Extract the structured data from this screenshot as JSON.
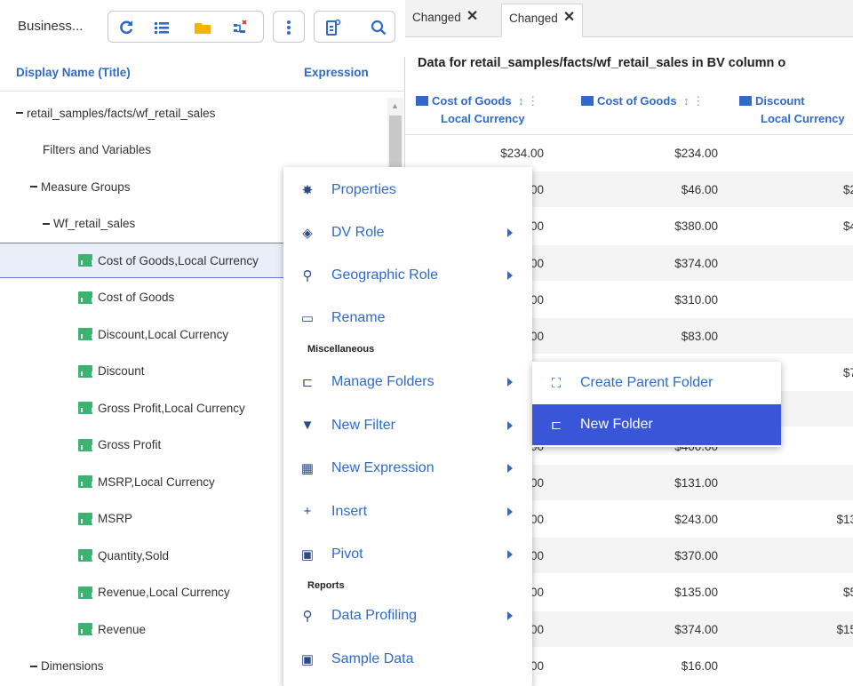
{
  "left_panel": {
    "title": "Business...",
    "col_display_name": "Display Name (Title)",
    "col_expression": "Expression",
    "tree": [
      {
        "label": "retail_samples/facts/wf_retail_sales",
        "type": "collapse"
      },
      {
        "label": "Filters and Variables",
        "type": "plain"
      },
      {
        "label": "Measure Groups",
        "type": "collapse"
      },
      {
        "label": "Wf_retail_sales",
        "type": "collapse"
      },
      {
        "label": "Cost of Goods,Local Currency",
        "type": "measure",
        "selected": true
      },
      {
        "label": "Cost of Goods",
        "type": "measure"
      },
      {
        "label": "Discount,Local Currency",
        "type": "measure"
      },
      {
        "label": "Discount",
        "type": "measure"
      },
      {
        "label": "Gross Profit,Local Currency",
        "type": "measure"
      },
      {
        "label": "Gross Profit",
        "type": "measure"
      },
      {
        "label": "MSRP,Local Currency",
        "type": "measure"
      },
      {
        "label": "MSRP",
        "type": "measure"
      },
      {
        "label": "Quantity,Sold",
        "type": "measure"
      },
      {
        "label": "Revenue,Local Currency",
        "type": "measure"
      },
      {
        "label": "Revenue",
        "type": "measure"
      },
      {
        "label": "Dimensions",
        "type": "collapse"
      }
    ]
  },
  "tabs": [
    {
      "label": "Changed"
    },
    {
      "label": "Changed"
    }
  ],
  "preview": {
    "title": "Data for retail_samples/facts/wf_retail_sales in BV column o",
    "headers": [
      {
        "line1": "Cost of Goods",
        "line2": "Local Currency"
      },
      {
        "line1": "Cost of Goods",
        "line2": ""
      },
      {
        "line1": "Discount",
        "line2": "Local Currency"
      }
    ],
    "rows": [
      [
        "$234.00",
        "$234.00",
        ""
      ],
      [
        "$46.00",
        "$46.00",
        "$2"
      ],
      [
        "$380.00",
        "$380.00",
        "$4"
      ],
      [
        "$374.00",
        "$374.00",
        ""
      ],
      [
        "$310.00",
        "$310.00",
        ""
      ],
      [
        "$83.00",
        "$83.00",
        ""
      ],
      [
        "",
        "",
        "$7"
      ],
      [
        "",
        "",
        ""
      ],
      [
        "$400.00",
        "$400.00",
        ""
      ],
      [
        "$131.00",
        "$131.00",
        ""
      ],
      [
        "$243.00",
        "$243.00",
        "$13"
      ],
      [
        "$370.00",
        "$370.00",
        ""
      ],
      [
        "$135.00",
        "$135.00",
        "$5"
      ],
      [
        "$374.00",
        "$374.00",
        "$15"
      ],
      [
        "$16.00",
        "$16.00",
        ""
      ]
    ],
    "left_fragments": [
      "6.00",
      "0.00",
      "4.00",
      "0.00",
      "3.00",
      "",
      "",
      "0.00",
      "1.00",
      "3.00",
      "0.00",
      "5.00",
      "4.00",
      "6.00"
    ]
  },
  "context_menu": {
    "items": [
      {
        "label": "Properties",
        "icon": "gear-icon",
        "submenu": false
      },
      {
        "label": "DV Role",
        "icon": "cube-icon",
        "submenu": true
      },
      {
        "label": "Geographic Role",
        "icon": "map-pin-icon",
        "submenu": true
      },
      {
        "label": "Rename",
        "icon": "rename-icon",
        "submenu": false
      }
    ],
    "section_misc": "Miscellaneous",
    "misc_items": [
      {
        "label": "Manage Folders",
        "icon": "folder-open-icon",
        "submenu": true
      },
      {
        "label": "New Filter",
        "icon": "filter-icon",
        "submenu": true
      },
      {
        "label": "New Expression",
        "icon": "calculator-icon",
        "submenu": true
      },
      {
        "label": "Insert",
        "icon": "plus-icon",
        "submenu": true
      },
      {
        "label": "Pivot",
        "icon": "pivot-icon",
        "submenu": true
      }
    ],
    "section_reports": "Reports",
    "report_items": [
      {
        "label": "Data Profiling",
        "icon": "search-icon",
        "submenu": true
      },
      {
        "label": "Sample Data",
        "icon": "sample-icon",
        "submenu": false
      }
    ]
  },
  "submenu": {
    "items": [
      {
        "label": "Create Parent Folder",
        "icon": "map-icon"
      },
      {
        "label": "New Folder",
        "icon": "folder-open-icon",
        "active": true
      }
    ]
  },
  "colors": {
    "accent": "#2f6ac9",
    "active_menu": "#3956d8",
    "measure_icon": "#3cb371"
  }
}
